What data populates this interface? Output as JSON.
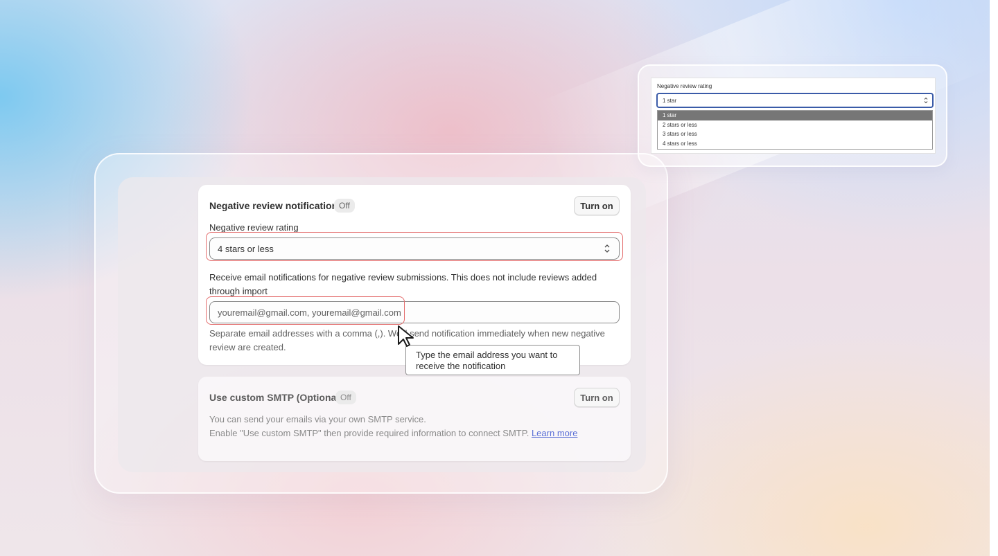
{
  "notification_card": {
    "title": "Negative review notification",
    "status": "Off",
    "turn_on_label": "Turn on",
    "rating_label": "Negative review rating",
    "rating_value": "4 stars or less",
    "description": "Receive email notifications for negative review submissions. This does not include reviews added through import",
    "email_value": "youremail@gmail.com, youremail@gmail.com",
    "help_text_1": "Separate email addresses with a comma (,). We'll send notification immediately when new negative",
    "help_text_2": "review are created."
  },
  "tooltip": {
    "text": "Type the email address you want to receive the notification"
  },
  "smtp_card": {
    "title": "Use custom SMTP (Optional)",
    "status": "Off",
    "turn_on_label": "Turn on",
    "line_1": "You can send your emails via your own SMTP service.",
    "line_2": "Enable \"Use custom SMTP\" then provide required information to connect SMTP.",
    "learn_more": "Learn more"
  },
  "dropdown_popup": {
    "label": "Negative review rating",
    "selected": "1 star",
    "options": [
      "1 star",
      "2 stars or less",
      "3 stars or less",
      "4 stars or less"
    ],
    "highlighted_index": 0
  },
  "colors": {
    "highlight": "#e36b6b",
    "focus_ring": "#3a5ba8",
    "link": "#5a6fd6"
  }
}
